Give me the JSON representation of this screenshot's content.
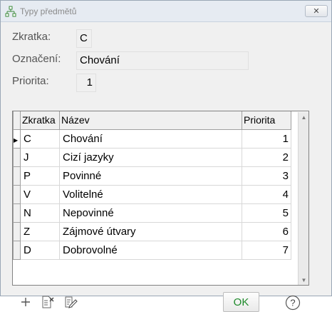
{
  "window": {
    "title": "Typy předmětů",
    "close_label": "✕"
  },
  "form": {
    "zkratka_label": "Zkratka:",
    "zkratka_value": "C",
    "oznaceni_label": "Označení:",
    "oznaceni_value": "Chování",
    "priorita_label": "Priorita:",
    "priorita_value": "1"
  },
  "grid": {
    "columns": [
      "Zkratka",
      "Název",
      "Priorita"
    ],
    "rows": [
      {
        "zkratka": "C",
        "nazev": "Chování",
        "priorita": "1"
      },
      {
        "zkratka": "J",
        "nazev": "Cizí jazyky",
        "priorita": "2"
      },
      {
        "zkratka": "P",
        "nazev": "Povinné",
        "priorita": "3"
      },
      {
        "zkratka": "V",
        "nazev": "Volitelné",
        "priorita": "4"
      },
      {
        "zkratka": "N",
        "nazev": "Nepovinné",
        "priorita": "5"
      },
      {
        "zkratka": "Z",
        "nazev": "Zájmové útvary",
        "priorita": "6"
      },
      {
        "zkratka": "D",
        "nazev": "Dobrovolné",
        "priorita": "7"
      }
    ],
    "selected_row": 0
  },
  "footer": {
    "ok_label": "OK",
    "help_label": "?"
  },
  "icons": {
    "add": "plus-icon",
    "delete": "delete-record-icon",
    "edit": "edit-record-icon"
  },
  "colors": {
    "ok_text": "#1e8a2a",
    "label_text": "#555555"
  }
}
